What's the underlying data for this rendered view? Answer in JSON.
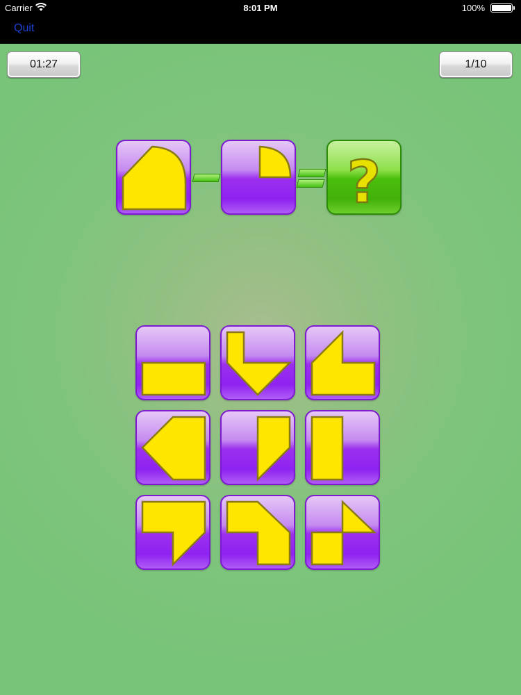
{
  "status_bar": {
    "carrier": "Carrier",
    "time": "8:01 PM",
    "battery": "100%"
  },
  "nav": {
    "quit_label": "Quit"
  },
  "hud": {
    "timer": "01:27",
    "progress": "1/10"
  },
  "equation": {
    "operator_1": "minus",
    "operator_2": "equals",
    "answer_symbol": "?"
  },
  "colors": {
    "background": "#7ac47a",
    "tile": "#9a2ff0",
    "shape_fill": "#ffe600",
    "shape_stroke": "#8a7a14",
    "answer_tile": "#4bbf0c"
  },
  "choices": {
    "count": 9
  }
}
